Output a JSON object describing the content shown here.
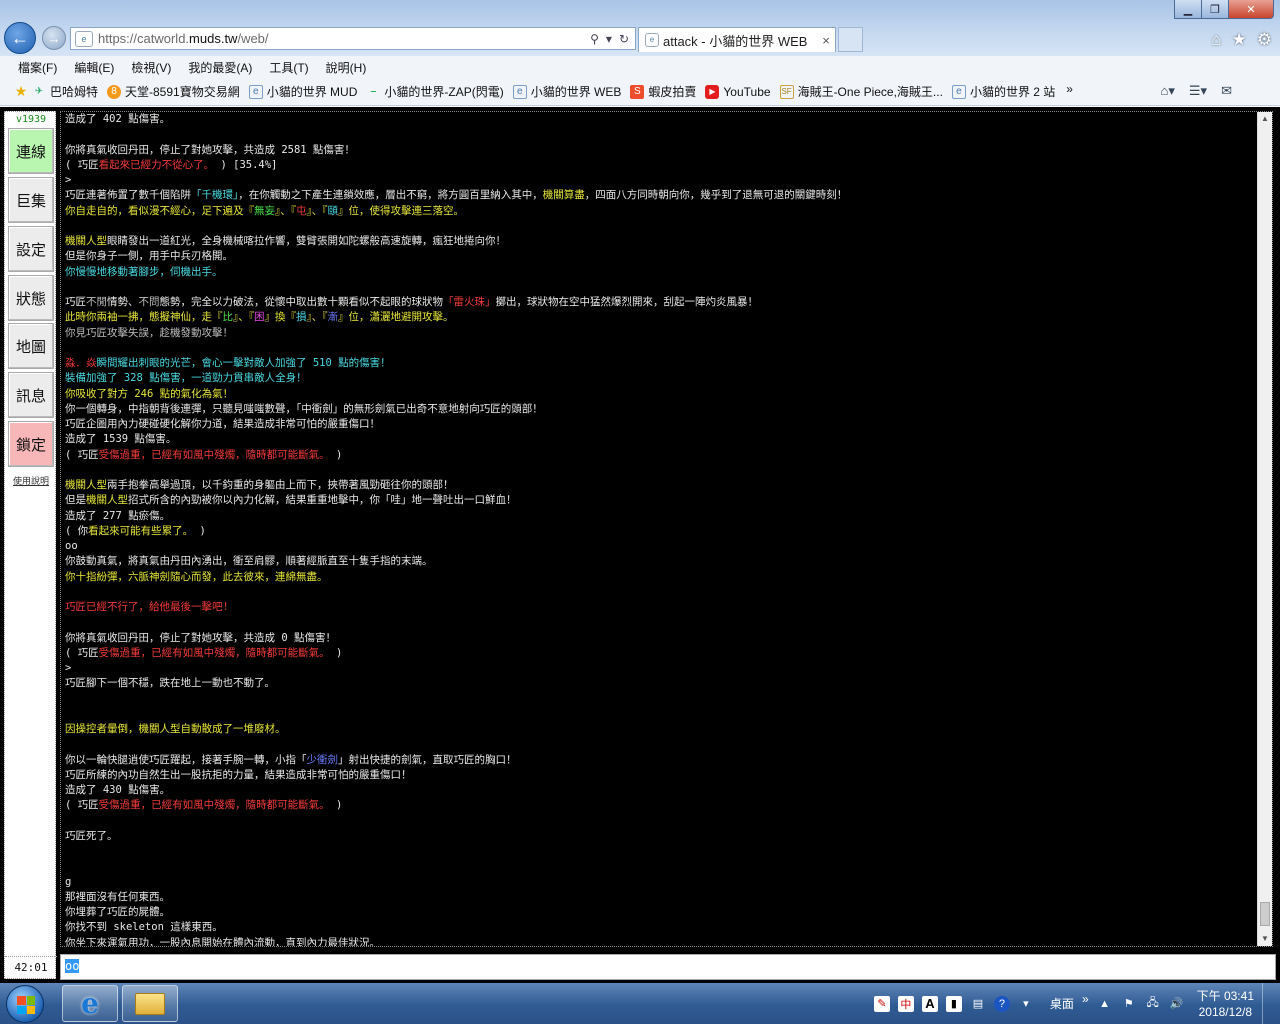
{
  "browser": {
    "url_prefix": "https://catworld.",
    "url_domain": "muds.tw",
    "url_suffix": "/web/",
    "tab_title": "attack - 小貓的世界 WEB",
    "tab_close": "×",
    "menu": [
      "檔案(F)",
      "編輯(E)",
      "檢視(V)",
      "我的最愛(A)",
      "工具(T)",
      "說明(H)"
    ],
    "favorites": [
      "巴哈姆特",
      "天堂-8591寶物交易網",
      "小貓的世界 MUD",
      "小貓的世界-ZAP(閃電)",
      "小貓的世界 WEB",
      "蝦皮拍賣",
      "YouTube",
      "海賊王-One Piece,海賊王...",
      "小貓的世界 2 站"
    ],
    "favbar_overflow": "»"
  },
  "sidebar": {
    "version": "v1939",
    "buttons": [
      "連線",
      "巨集",
      "設定",
      "狀態",
      "地圖",
      "訊息",
      "鎖定"
    ],
    "usage_link": "使用說明",
    "timer": "42:01"
  },
  "log_lines": [
    [
      [
        "",
        "造成了 402 點傷害。"
      ]
    ],
    [],
    [
      [
        "",
        "你將真氣收回丹田，停止了對她攻擊，共造成 2581 點傷害！"
      ]
    ],
    [
      [
        "",
        "( 巧匠"
      ],
      [
        "r",
        "看起來已經力不從心了。"
      ],
      [
        "",
        " ) [35.4%]"
      ]
    ],
    [
      [
        "",
        ">"
      ]
    ],
    [
      [
        "",
        "巧匠連著佈置了數千個陷阱"
      ],
      [
        "c",
        "「千機環」"
      ],
      [
        "",
        "，在你觸動之下產生連鎖效應，層出不窮，將方圓百里納入其中，"
      ],
      [
        "y",
        "機關算盡"
      ],
      [
        "",
        "，四面八方同時朝向你，幾乎到了退無可退的關鍵時刻！"
      ]
    ],
    [
      [
        "y",
        "你自走自的，看似漫不經心，足下遍及『"
      ],
      [
        "g",
        "無妄"
      ],
      [
        "y",
        "』、『"
      ],
      [
        "r",
        "屯"
      ],
      [
        "y",
        "』、『"
      ],
      [
        "c",
        "頤"
      ],
      [
        "y",
        "』位，使得攻擊連三落空。"
      ]
    ],
    [],
    [
      [
        "y",
        "機關人型"
      ],
      [
        "",
        "眼睛發出一道紅光，全身機械喀拉作響，雙臂張開如陀螺般高速旋轉，瘋狂地捲向你！"
      ]
    ],
    [
      [
        "",
        "但是你身子一側，用手中兵刃格開。"
      ]
    ],
    [
      [
        "c",
        "你慢慢地移動著腳步，伺機出手。"
      ]
    ],
    [],
    [
      [
        "",
        "巧匠"
      ],
      [
        "dk",
        "不閒"
      ],
      [
        "",
        "情勢、"
      ],
      [
        "dk",
        "不問"
      ],
      [
        "",
        "態勢，完全以力破法，從懷中取出數十顆看似不起眼的球狀物"
      ],
      [
        "r",
        "「雷火珠」"
      ],
      [
        "",
        "擲出，球狀物在空中猛然爆烈開來，刮起一陣灼炎風暴！"
      ]
    ],
    [
      [
        "y",
        "此時你兩袖一拂，態擬神仙，走『"
      ],
      [
        "g",
        "比"
      ],
      [
        "y",
        "』、『"
      ],
      [
        "m",
        "困"
      ],
      [
        "y",
        "』換『"
      ],
      [
        "c",
        "損"
      ],
      [
        "y",
        "』、『"
      ],
      [
        "b",
        "漸"
      ],
      [
        "y",
        "』位，瀟灑地避開攻擊。"
      ]
    ],
    [
      [
        "dk",
        "你見巧匠攻擊失誤，趁機發動攻擊！"
      ]
    ],
    [],
    [
      [
        "r",
        "淼．焱"
      ],
      [
        "c",
        "瞬間耀出刺眼的光芒，會心一擊對敵人加強了 510 點的傷害！"
      ]
    ],
    [
      [
        "c",
        "裝備加強了 328 點傷害，一道勁力貫串敵人全身！"
      ]
    ],
    [
      [
        "y",
        "你吸收了對方 246 點的氣化為氣！"
      ]
    ],
    [
      [
        "",
        "你一個轉身，中指朝背後連彈，只聽見嗤嗤數聲，「中衝劍」的無形劍氣已出奇不意地射向巧匠的頭部！"
      ]
    ],
    [
      [
        "",
        "巧匠企圖用內力硬碰硬化解你力道，結果造成非常可怕的嚴重傷口！"
      ]
    ],
    [
      [
        "",
        "造成了 1539 點傷害。"
      ]
    ],
    [
      [
        "",
        "( 巧匠"
      ],
      [
        "r",
        "受傷過重，已經有如風中殘燭，隨時都可能斷氣。"
      ],
      [
        "",
        " )"
      ]
    ],
    [],
    [
      [
        "y",
        "機關人型"
      ],
      [
        "",
        "兩手抱拳高舉過頂，以千鈞重的身軀由上而下，挾帶著風勁砸往你的頭部！"
      ]
    ],
    [
      [
        "",
        "但是"
      ],
      [
        "y",
        "機關人型"
      ],
      [
        "",
        "招式所含的內勁被你以內力化解，結果重重地擊中，你「哇」地一聲吐出一口鮮血！"
      ]
    ],
    [
      [
        "",
        "造成了 277 點瘀傷。"
      ]
    ],
    [
      [
        "",
        "( 你"
      ],
      [
        "y",
        "看起來可能有些累了。"
      ],
      [
        "",
        " )"
      ]
    ],
    [
      [
        "",
        "oo"
      ]
    ],
    [
      [
        "",
        "你鼓動真氣，將真氣由丹田內湧出，衝至肩髎，順著經脈直至十隻手指的末端。"
      ]
    ],
    [
      [
        "y",
        "你十指紛彈，六脈神劍隨心而發，此去彼來，連綿無盡。"
      ]
    ],
    [],
    [
      [
        "r",
        "巧匠已經不行了，給他最後一擊吧!"
      ]
    ],
    [],
    [
      [
        "",
        "你將真氣收回丹田，停止了對她攻擊，共造成 0 點傷害！"
      ]
    ],
    [
      [
        "",
        "( 巧匠"
      ],
      [
        "r",
        "受傷過重，已經有如風中殘燭，隨時都可能斷氣。"
      ],
      [
        "",
        " )"
      ]
    ],
    [
      [
        "",
        ">"
      ]
    ],
    [
      [
        "",
        "巧匠腳下一個不穩，跌在地上一動也不動了。"
      ]
    ],
    [],
    [],
    [
      [
        "y",
        "因操控者暈倒，機關人型自動散成了一堆廢材。"
      ]
    ],
    [],
    [
      [
        "",
        "你以一輪快腿逍使巧匠躍起，接著手腕一轉，小指「"
      ],
      [
        "b",
        "少衝劍"
      ],
      [
        "",
        "」射出快捷的劍氣，直取巧匠的胸口！"
      ]
    ],
    [
      [
        "",
        "巧匠所練的內功自然生出一股抗拒的力量，結果造成非常可怕的嚴重傷口！"
      ]
    ],
    [
      [
        "",
        "造成了 430 點傷害。"
      ]
    ],
    [
      [
        "",
        "( 巧匠"
      ],
      [
        "r",
        "受傷過重，已經有如風中殘燭，隨時都可能斷氣。"
      ],
      [
        "",
        " )"
      ]
    ],
    [],
    [
      [
        "",
        "巧匠死了。"
      ]
    ],
    [],
    [],
    [
      [
        "",
        "g"
      ]
    ],
    [
      [
        "",
        "那裡面沒有任何東西。"
      ]
    ],
    [
      [
        "",
        "你埋葬了巧匠的屍體。"
      ]
    ],
    [
      [
        "",
        "你找不到 skeleton 這樣東西。"
      ]
    ],
    [
      [
        "",
        "你坐下來運氣用功，一股內息開始在體內流動，直到內力最佳狀況。"
      ]
    ],
    [],
    [
      [
        "",
        ">"
      ]
    ]
  ],
  "command_input": "oo",
  "taskbar": {
    "desktop_label": "桌面",
    "overflow": "»",
    "time": "下午 03:41",
    "date": "2018/12/8",
    "tray_icons": [
      "acrobat-icon",
      "ime-icon",
      "font-a-icon",
      "keyboard-icon",
      "help-icon",
      "flag-icon",
      "network-icon",
      "volume-icon"
    ]
  },
  "colors": {
    "red": "#f23b3b",
    "yellow": "#e5e53a",
    "cyan": "#48d9e0",
    "green": "#4ce24c",
    "blue": "#6e7bff",
    "magenta": "#e24ce0",
    "connect_btn": "#b9f7b1",
    "lock_btn": "#f7b7b9"
  }
}
